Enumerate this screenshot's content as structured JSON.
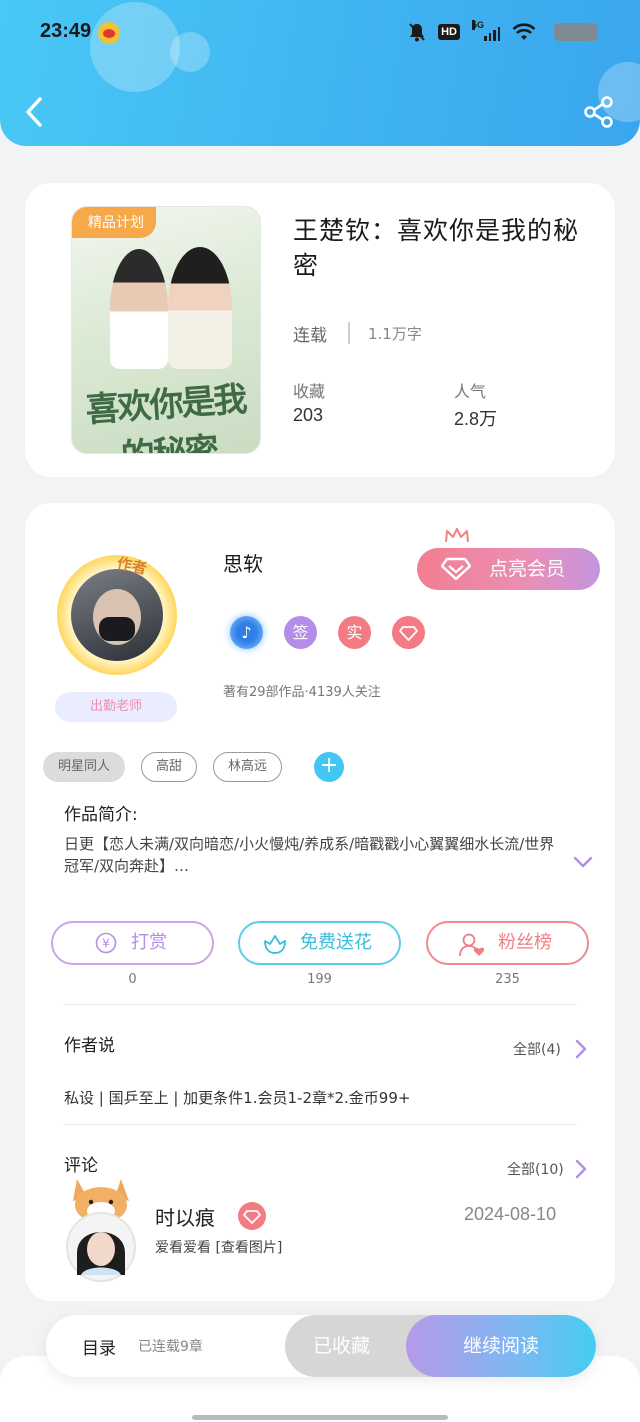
{
  "status_bar": {
    "time": "23:49",
    "hd": "HD",
    "network": "5G"
  },
  "book": {
    "cover_tag": "精品计划",
    "cover_title": "喜欢你是我的秘密",
    "title": "王楚钦：喜欢你是我的秘密",
    "status": "连载",
    "word_count": "1.1万字",
    "favorites_label": "收藏",
    "favorites_value": "203",
    "popularity_label": "人气",
    "popularity_value": "2.8万"
  },
  "author": {
    "badge": "作者",
    "name": "思软",
    "teacher_tag": "出勤老师",
    "vip_button": "点亮会员",
    "badges": [
      "签",
      "实"
    ],
    "stats": "著有29部作品·4139人关注"
  },
  "tags": [
    "明星同人",
    "高甜",
    "林高远"
  ],
  "tag_add": "+",
  "intro": {
    "heading": "作品简介:",
    "text": "日更【恋人未满/双向暗恋/小火慢炖/养成系/暗戳戳小心翼翼细水长流/世界冠军/双向奔赴】…"
  },
  "actions": [
    {
      "label": "打赏",
      "count": "0",
      "color": "#b48de8"
    },
    {
      "label": "免费送花",
      "count": "199",
      "color": "#39bcd9"
    },
    {
      "label": "粉丝榜",
      "count": "235",
      "color": "#ee7f85"
    }
  ],
  "author_say": {
    "heading": "作者说",
    "more": "全部(4)",
    "text": "私设 | 国乒至上 | 加更条件1.会员1-2章*2.金币99+"
  },
  "comments": {
    "heading": "评论",
    "more": "全部(10)",
    "items": [
      {
        "user": "时以痕",
        "date": "2024-08-10",
        "text": "爱看爱看 [查看图片]"
      }
    ]
  },
  "bottom_bar": {
    "toc": "目录",
    "toc_count": "已连载9章",
    "collected": "已收藏",
    "continue": "继续阅读"
  },
  "colors": {
    "header": "#3fb2f0",
    "accent_blue": "#44c6f2",
    "vip_pink": "#f47e8f"
  }
}
